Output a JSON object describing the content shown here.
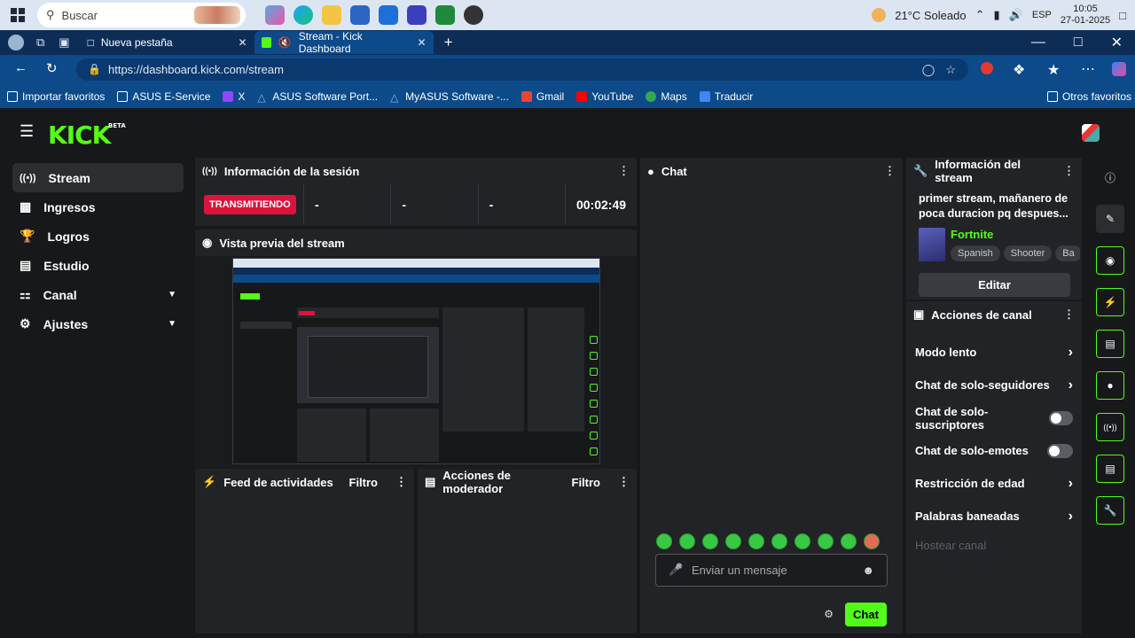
{
  "taskbar": {
    "search_placeholder": "Buscar",
    "weather": "21°C  Soleado",
    "lang": "ESP",
    "time": "10:05",
    "date": "27-01-2025"
  },
  "browser": {
    "tabs": [
      {
        "label": "Nueva pestaña"
      },
      {
        "label": "Stream - Kick Dashboard"
      }
    ],
    "url": "https://dashboard.kick.com/stream",
    "favorites": [
      "Importar favoritos",
      "ASUS E-Service",
      "X",
      "ASUS Software Port...",
      "MyASUS Software -...",
      "Gmail",
      "YouTube",
      "Maps",
      "Traducir"
    ],
    "other_favorites": "Otros favoritos"
  },
  "app": {
    "logo": "KICK",
    "logo_badge": "BETA",
    "nav": [
      {
        "label": "Stream",
        "icon": "stream-icon"
      },
      {
        "label": "Ingresos",
        "icon": "revenue-icon"
      },
      {
        "label": "Logros",
        "icon": "trophy-icon"
      },
      {
        "label": "Estudio",
        "icon": "studio-icon"
      },
      {
        "label": "Canal",
        "icon": "channel-icon"
      },
      {
        "label": "Ajustes",
        "icon": "gear-icon"
      }
    ],
    "session": {
      "title": "Información de la sesión",
      "status": "TRANSMITIENDO",
      "stats": [
        "-",
        "-",
        "-"
      ],
      "timer": "00:02:49"
    },
    "preview": {
      "title": "Vista previa del stream"
    },
    "activity": {
      "title": "Feed de actividades",
      "filter": "Filtro"
    },
    "moderator": {
      "title": "Acciones de moderador",
      "filter": "Filtro"
    },
    "chat": {
      "title": "Chat",
      "placeholder": "Enviar un mensaje",
      "send": "Chat"
    },
    "stream_info": {
      "title": "Información del stream",
      "stream_title": "primer stream, mañanero de poca duracion pq despues...",
      "category": "Fortnite",
      "tags": [
        "Spanish",
        "Shooter",
        "Ba"
      ],
      "edit": "Editar"
    },
    "channel_actions": {
      "title": "Acciones de canal",
      "items": [
        {
          "label": "Modo lento",
          "kind": "arrow"
        },
        {
          "label": "Chat de solo-seguidores",
          "kind": "arrow"
        },
        {
          "label": "Chat de solo-suscriptores",
          "kind": "toggle"
        },
        {
          "label": "Chat de solo-emotes",
          "kind": "toggle"
        },
        {
          "label": "Restricción de edad",
          "kind": "arrow"
        },
        {
          "label": "Palabras baneadas",
          "kind": "arrow"
        }
      ],
      "host": "Hostear canal"
    }
  }
}
